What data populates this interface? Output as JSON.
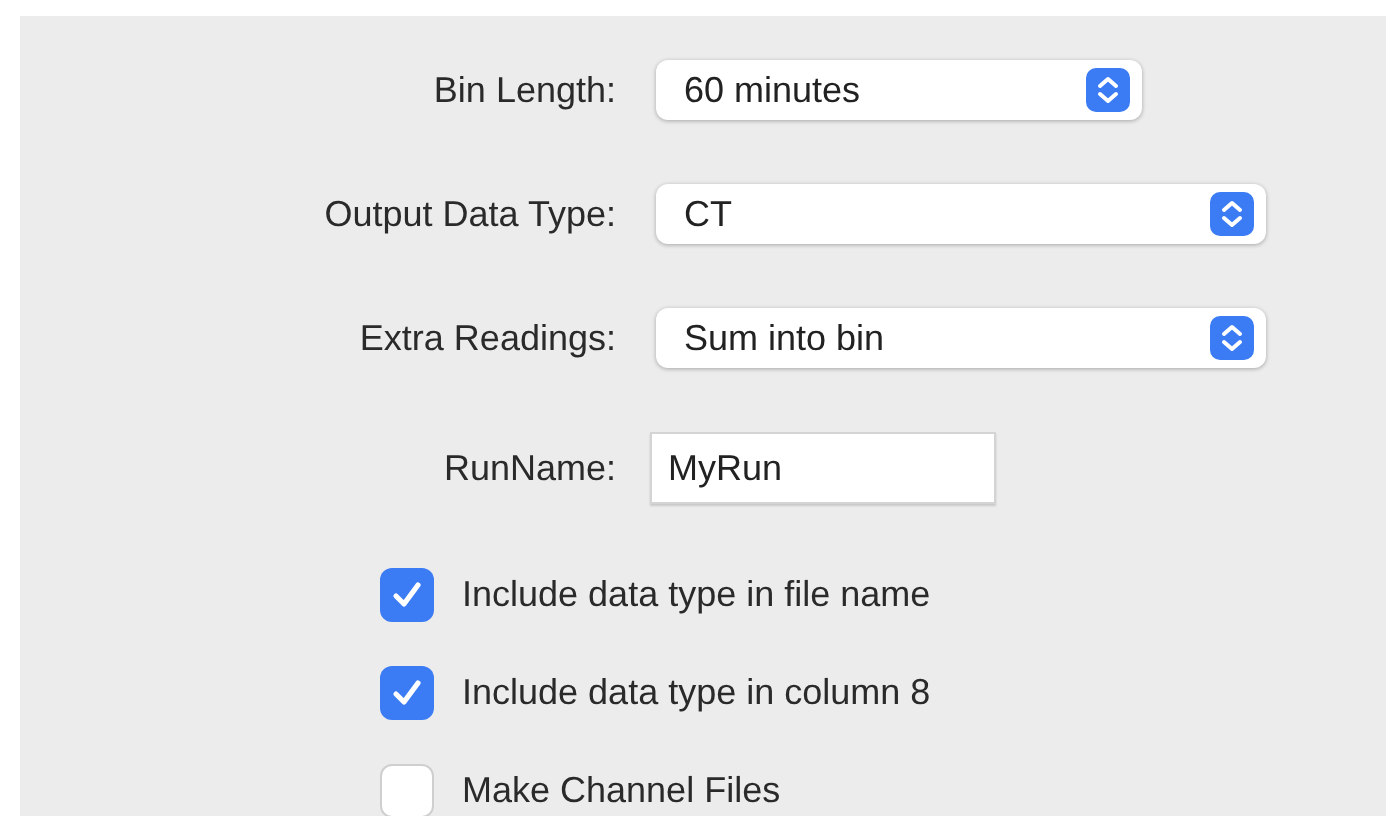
{
  "fields": [
    {
      "label": "Bin Length:",
      "kind": "shortpopup",
      "value": "60 minutes"
    },
    {
      "label": "Output Data Type:",
      "kind": "popup",
      "value": "CT"
    },
    {
      "label": "Extra Readings:",
      "kind": "popup",
      "value": "Sum into bin"
    },
    {
      "label": "RunName:",
      "kind": "text",
      "value": "MyRun"
    }
  ],
  "checkboxes": [
    {
      "label": "Include data type in file name",
      "checked": true
    },
    {
      "label": "Include data type in column 8",
      "checked": true
    },
    {
      "label": "Make Channel Files",
      "checked": false
    }
  ]
}
